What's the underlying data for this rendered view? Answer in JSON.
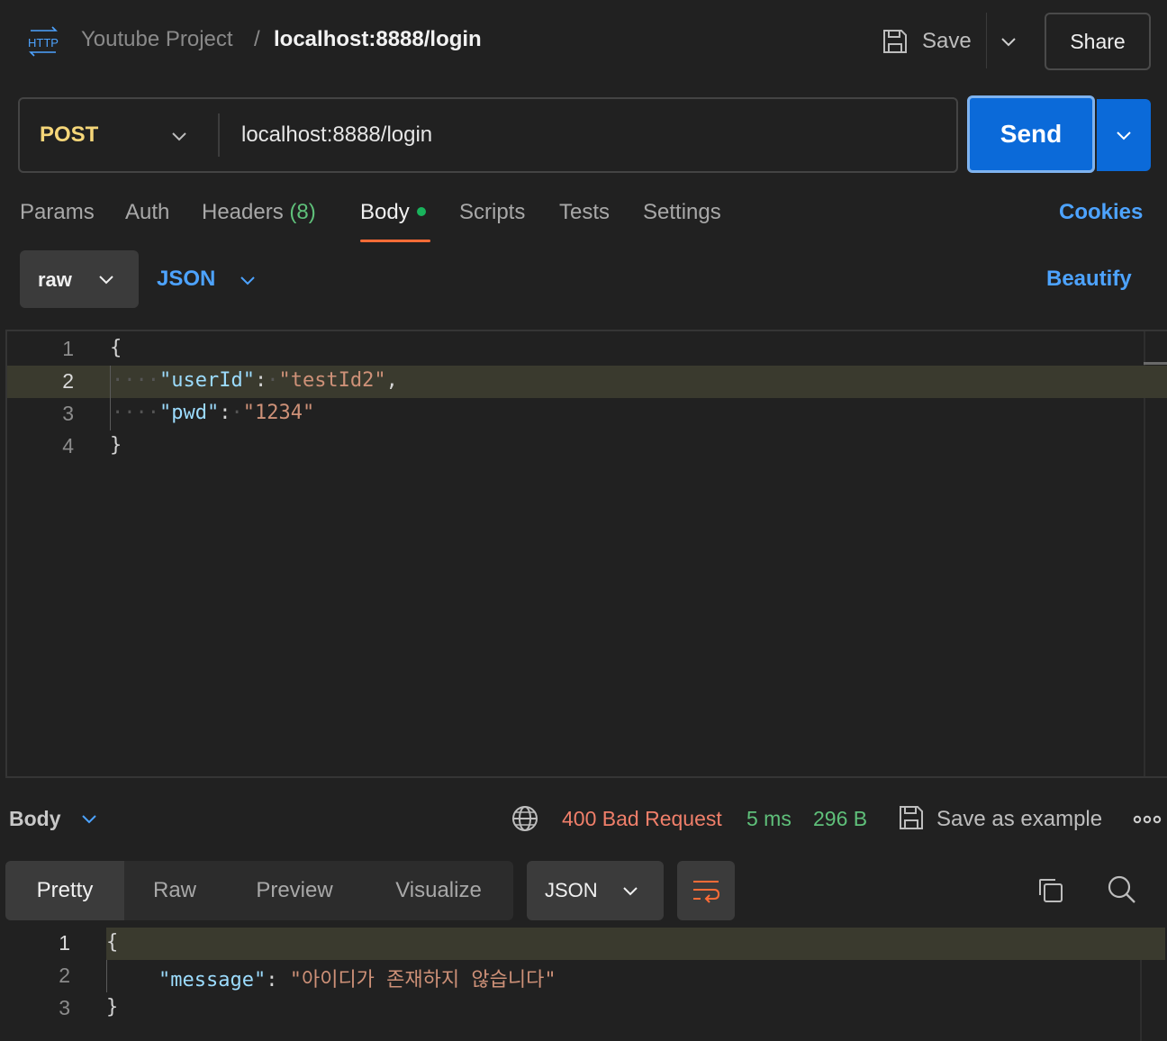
{
  "header": {
    "icon_text": "HTTP",
    "project": "Youtube Project",
    "separator": "/",
    "title": "localhost:8888/login",
    "save_label": "Save",
    "share_label": "Share"
  },
  "request": {
    "method": "POST",
    "url": "localhost:8888/login",
    "send_label": "Send"
  },
  "tabs": {
    "params": "Params",
    "auth": "Auth",
    "headers": "Headers",
    "headers_count": "(8)",
    "body": "Body",
    "scripts": "Scripts",
    "tests": "Tests",
    "settings": "Settings",
    "cookies": "Cookies"
  },
  "body_options": {
    "mode": "raw",
    "language": "JSON",
    "beautify": "Beautify"
  },
  "request_body": {
    "lines": [
      {
        "num": "1",
        "open": "{"
      },
      {
        "num": "2",
        "key": "\"userId\"",
        "colon": ":",
        "value": "\"testId2\"",
        "comma": ","
      },
      {
        "num": "3",
        "key": "\"pwd\"",
        "colon": ":",
        "value": "\"1234\""
      },
      {
        "num": "4",
        "close": "}"
      }
    ]
  },
  "response": {
    "section_label": "Body",
    "status": "400 Bad Request",
    "time": "5 ms",
    "size": "296 B",
    "save_example": "Save as example",
    "views": [
      "Pretty",
      "Raw",
      "Preview",
      "Visualize"
    ],
    "format": "JSON",
    "lines": [
      {
        "num": "1",
        "open": "{"
      },
      {
        "num": "2",
        "key": "\"message\"",
        "colon": ":",
        "value": "\"아이디가 존재하지 않습니다\""
      },
      {
        "num": "3",
        "close": "}"
      }
    ]
  },
  "colors": {
    "accent_blue": "#0b6ad9",
    "link_blue": "#4da3ff",
    "method_yellow": "#f5d679",
    "status_red": "#f07f6a",
    "success_green": "#5fc07a",
    "tab_underline": "#ff6c37"
  }
}
